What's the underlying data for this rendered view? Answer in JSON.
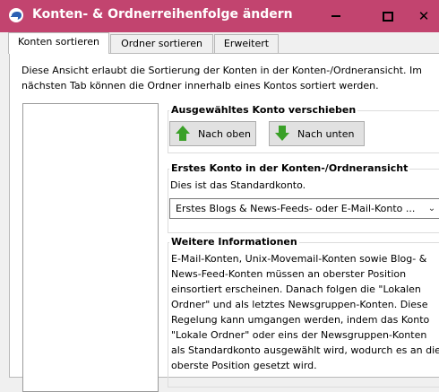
{
  "window": {
    "title": "Konten- & Ordnerreihenfolge ändern",
    "close_glyph": "✕"
  },
  "tabs": [
    {
      "label": "Konten sortieren",
      "active": true
    },
    {
      "label": "Ordner sortieren",
      "active": false
    },
    {
      "label": "Erweitert",
      "active": false
    }
  ],
  "intro_text": "Diese Ansicht erlaubt die Sortierung der Konten in der Konten-/Ordneransicht. Im nächsten Tab können die Ordner innerhalb eines Kontos sortiert werden.",
  "move_group": {
    "title": "Ausgewähltes Konto verschieben",
    "up_label": "Nach oben",
    "down_label": "Nach unten"
  },
  "first_account_group": {
    "title": "Erstes Konto in der Konten-/Ordneransicht",
    "description": "Dies ist das Standardkonto.",
    "selected": "Erstes Blogs & News-Feeds- oder E-Mail-Konto ..."
  },
  "info_group": {
    "title": "Weitere Informationen",
    "text": "E-Mail-Konten, Unix-Movemail-Konten sowie Blog- & News-Feed-Konten müssen an oberster Position einsortiert erscheinen. Danach folgen die \"Lokalen Ordner\" und als letztes Newsgruppen-Konten. Diese Regelung kann umgangen werden, indem das Konto \"Lokale Ordner\" oder eins der Newsgruppen-Konten als Standardkonto ausgewählt wird, wodurch es an die oberste Position gesetzt wird."
  },
  "colors": {
    "titlebar": "#c2446f",
    "arrow_green": "#3aa028"
  }
}
